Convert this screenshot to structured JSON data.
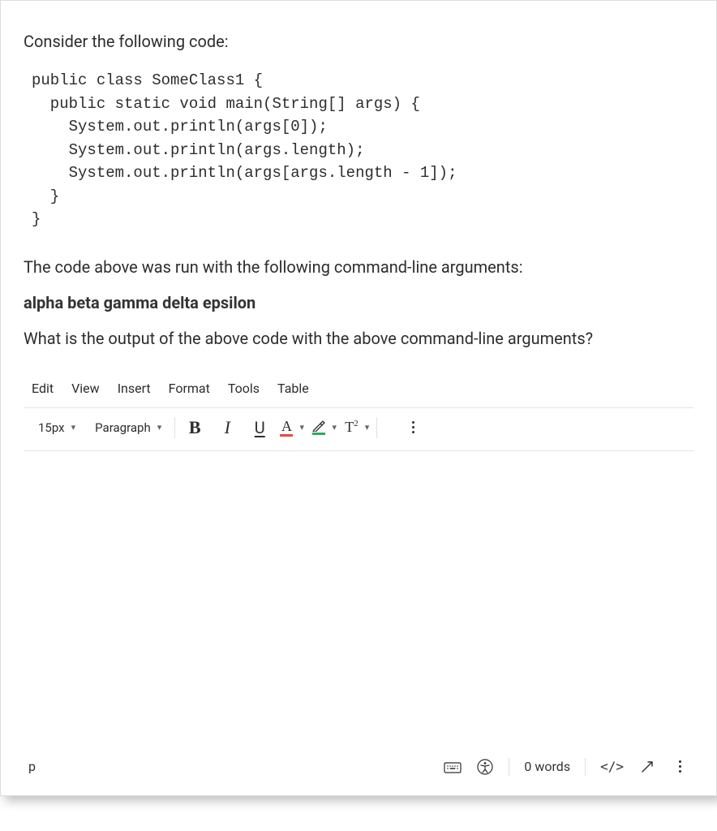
{
  "question": {
    "intro": "Consider the following code:",
    "code": "public class SomeClass1 {\n  public static void main(String[] args) {\n    System.out.println(args[0]);\n    System.out.println(args.length);\n    System.out.println(args[args.length - 1]);\n  }\n}",
    "run_prefix": "The code above was run with the following command-line arguments:",
    "cli_args": "alpha beta gamma delta epsilon",
    "prompt_question": "What is the output of the above code with the above command-line arguments?"
  },
  "editor": {
    "menus": {
      "edit": "Edit",
      "view": "View",
      "insert": "Insert",
      "format": "Format",
      "tools": "Tools",
      "table": "Table"
    },
    "toolbar": {
      "font_size": "15px",
      "paragraph": "Paragraph",
      "bold": "B",
      "italic": "I",
      "underline": "U",
      "text_color_letter": "A",
      "superscript": "T",
      "superscript_exp": "2"
    },
    "status": {
      "path": "p",
      "word_count": "0 words",
      "html_view": "</>"
    }
  }
}
